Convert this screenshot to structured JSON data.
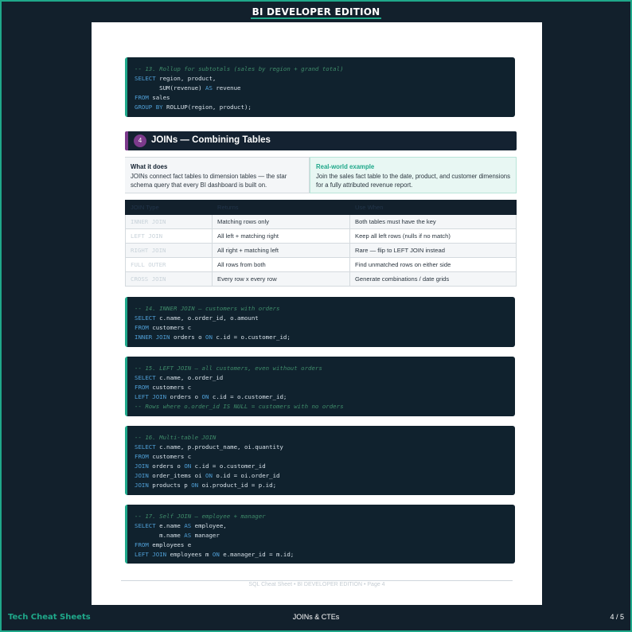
{
  "header": {
    "title": "BI DEVELOPER EDITION"
  },
  "code13": {
    "comment": "-- 13. Rollup for subtotals (sales by region + grand total)",
    "l1_kw": "SELECT",
    "l1_rest": " region, product,",
    "l2_a": "       SUM(revenue) ",
    "l2_kw": "AS",
    "l2_b": " revenue",
    "l3_kw": "FROM",
    "l3_rest": " sales",
    "l4_kw": "GROUP BY",
    "l4_rest": " ROLLUP(region, product);"
  },
  "section": {
    "number": "4",
    "title": "JOINs — Combining Tables"
  },
  "what_it_does": {
    "heading": "What it does",
    "body": "JOINs connect fact tables to dimension tables — the star schema query that every BI dashboard is built on."
  },
  "real_world": {
    "heading": "Real-world example",
    "body": "Join the sales fact table to the date, product, and customer dimensions for a fully attributed revenue report."
  },
  "join_table": {
    "headers": [
      "JOIN Type",
      "Returns",
      "Use When"
    ],
    "rows": [
      [
        "INNER JOIN",
        "Matching rows only",
        "Both tables must have the key"
      ],
      [
        "LEFT JOIN",
        "All left + matching right",
        "Keep all left rows (nulls if no match)"
      ],
      [
        "RIGHT JOIN",
        "All right + matching left",
        "Rare — flip to LEFT JOIN instead"
      ],
      [
        "FULL OUTER",
        "All rows from both",
        "Find unmatched rows on either side"
      ],
      [
        "CROSS JOIN",
        "Every row x every row",
        "Generate combinations / date grids"
      ]
    ]
  },
  "code14": {
    "comment": "-- 14. INNER JOIN — customers with orders",
    "l1_kw": "SELECT",
    "l1_rest": " c.name, o.order_id, o.amount",
    "l2_kw": "FROM",
    "l2_rest": " customers c",
    "l3_kw": "INNER JOIN",
    "l3_a": " orders o ",
    "l3_kw2": "ON",
    "l3_b": " c.id = o.customer_id;"
  },
  "code15": {
    "comment": "-- 15. LEFT JOIN — all customers, even without orders",
    "l1_kw": "SELECT",
    "l1_rest": " c.name, o.order_id",
    "l2_kw": "FROM",
    "l2_rest": " customers c",
    "l3_kw": "LEFT JOIN",
    "l3_a": " orders o ",
    "l3_kw2": "ON",
    "l3_b": " c.id = o.customer_id;",
    "comment2": "-- Rows where o.order_id IS NULL = customers with no orders"
  },
  "code16": {
    "comment": "-- 16. Multi-table JOIN",
    "l1_kw": "SELECT",
    "l1_rest": " c.name, p.product_name, oi.quantity",
    "l2_kw": "FROM",
    "l2_rest": " customers c",
    "l3_kw": "JOIN",
    "l3_a": " orders o ",
    "l3_kw2": "ON",
    "l3_b": " c.id = o.customer_id",
    "l4_kw": "JOIN",
    "l4_a": " order_items oi ",
    "l4_kw2": "ON",
    "l4_b": " o.id = oi.order_id",
    "l5_kw": "JOIN",
    "l5_a": " products p ",
    "l5_kw2": "ON",
    "l5_b": " oi.product_id = p.id;"
  },
  "code17": {
    "comment": "-- 17. Self JOIN — employee + manager",
    "l1_kw": "SELECT",
    "l1_a": " e.name ",
    "l1_kw2": "AS",
    "l1_b": " employee,",
    "l2_a": "       m.name ",
    "l2_kw": "AS",
    "l2_b": " manager",
    "l3_kw": "FROM",
    "l3_rest": " employees e",
    "l4_kw": "LEFT JOIN",
    "l4_a": " employees m ",
    "l4_kw2": "ON",
    "l4_b": " e.manager_id = m.id;"
  },
  "page_footer": "SQL Cheat Sheet  •  BI DEVELOPER EDITION  •  Page 4",
  "bottom": {
    "brand": "Tech Cheat Sheets",
    "section": "JOINs & CTEs",
    "page": "4 / 5"
  }
}
